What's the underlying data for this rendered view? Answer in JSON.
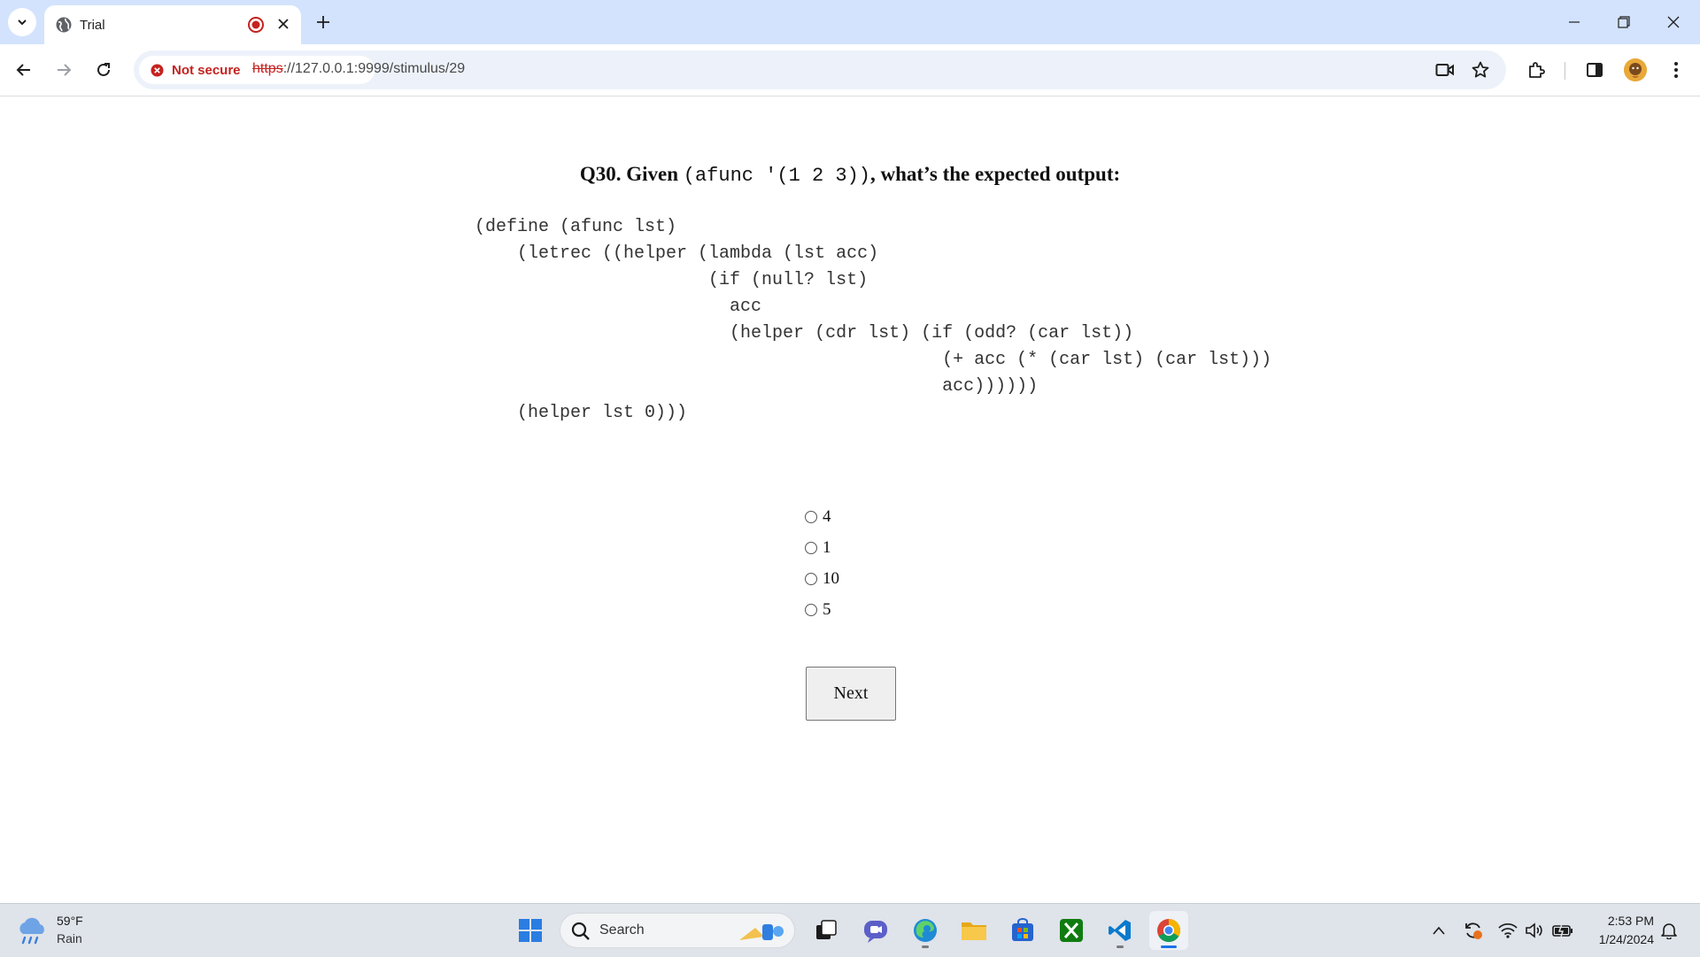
{
  "browser": {
    "tab_title": "Trial",
    "security_label": "Not secure",
    "url_scheme": "https",
    "url_rest": "://127.0.0.1:9999/stimulus/29"
  },
  "question": {
    "prefix": "Q30. Given ",
    "code_inline": "(afunc '(1 2 3))",
    "suffix": ", what’s the expected output:"
  },
  "code_lines": [
    "(define (afunc lst)",
    "    (letrec ((helper (lambda (lst acc)",
    "                      (if (null? lst)",
    "                        acc",
    "                        (helper (cdr lst) (if (odd? (car lst))",
    "                                            (+ acc (* (car lst) (car lst)))",
    "                                            acc))))))",
    "    (helper lst 0)))"
  ],
  "options": [
    "4",
    "1",
    "10",
    "5"
  ],
  "next_label": "Next",
  "taskbar": {
    "weather_temp": "59°F",
    "weather_condition": "Rain",
    "search_label": "Search",
    "time": "2:53 PM",
    "date": "1/24/2024"
  },
  "icons": {
    "tab_search": "chevron-down-icon",
    "favicon": "globe-icon",
    "recording": "record-icon",
    "security": "error-icon",
    "start": "windows-start-icon",
    "edge": "edge-icon",
    "chrome": "chrome-icon"
  },
  "colors": {
    "tabstrip": "#d3e3fd",
    "omnibox": "#edf2fa",
    "insecure": "#c5221f",
    "taskbar": "#dfe3ea"
  }
}
